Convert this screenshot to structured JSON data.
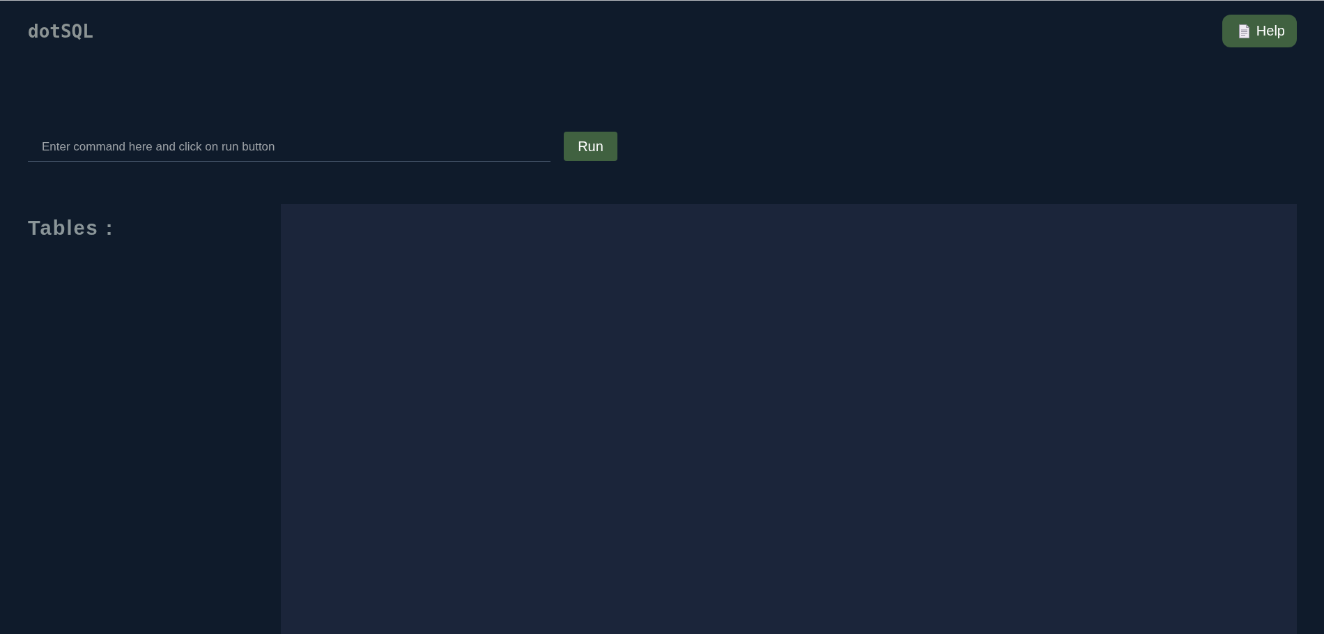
{
  "header": {
    "logo": "dotSQL",
    "help_button": {
      "label": "Help"
    }
  },
  "command": {
    "placeholder": "Enter command here and click on run button",
    "run_button": {
      "label": "Run"
    }
  },
  "tables": {
    "title": "Tables :"
  }
}
